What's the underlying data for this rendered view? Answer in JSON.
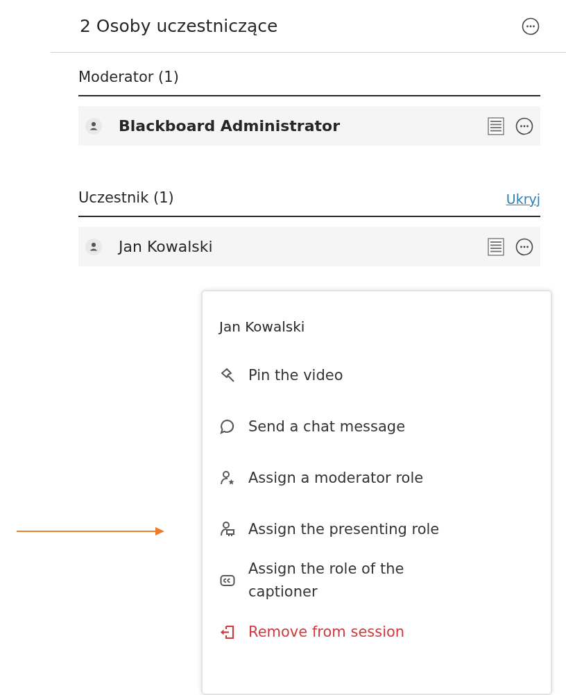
{
  "panel": {
    "title": "2 Osoby uczestniczące"
  },
  "groups": [
    {
      "heading": "Moderator (1)",
      "members": [
        {
          "name": "Blackboard Administrator",
          "bold": true
        }
      ]
    },
    {
      "heading": "Uczestnik (1)",
      "toggle": "Ukryj",
      "members": [
        {
          "name": "Jan Kowalski",
          "bold": false
        }
      ]
    }
  ],
  "menu": {
    "title": "Jan Kowalski",
    "items": [
      {
        "label": "Pin the video",
        "kind": "normal"
      },
      {
        "label": "Send a chat message",
        "kind": "normal"
      },
      {
        "label": "Assign a moderator role",
        "kind": "normal"
      },
      {
        "label": "Assign the presenting role",
        "kind": "normal"
      },
      {
        "label": "Assign the role of the captioner",
        "kind": "normal"
      },
      {
        "label": "Remove from session",
        "kind": "danger"
      }
    ]
  }
}
